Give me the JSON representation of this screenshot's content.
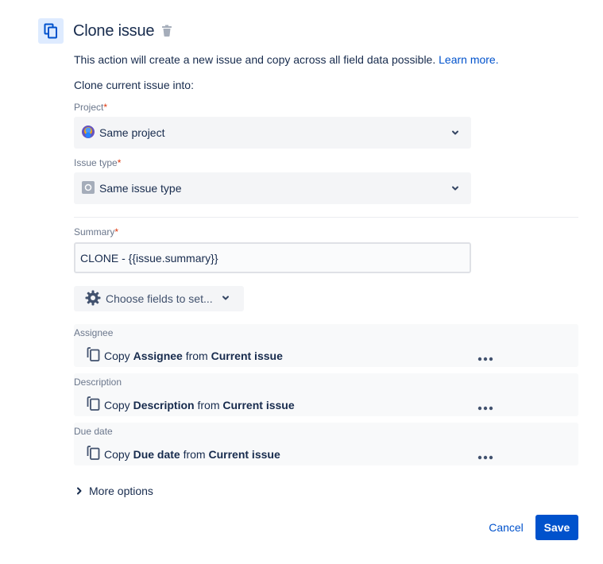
{
  "header": {
    "title": "Clone issue",
    "icon": "clone-icon",
    "delete_icon": "trash-icon",
    "accent_bg": "#deebff",
    "accent": "#0052cc"
  },
  "description": {
    "text": "This action will create a new issue and copy across all field data possible.",
    "link": "Learn more."
  },
  "subtitle": "Clone current issue into:",
  "project": {
    "label": "Project",
    "required": "*",
    "value": "Same project",
    "icon": "project-avatar-icon"
  },
  "issue_type": {
    "label": "Issue type",
    "required": "*",
    "value": "Same issue type",
    "icon": "issue-type-icon"
  },
  "summary": {
    "label": "Summary",
    "required": "*",
    "value": "CLONE - {{issue.summary}}"
  },
  "choose_fields": {
    "label": "Choose fields to set...",
    "icon": "gear-icon"
  },
  "fields": [
    {
      "label": "Assignee",
      "copy": "Copy",
      "field": "Assignee",
      "from": "from",
      "source": "Current issue"
    },
    {
      "label": "Description",
      "copy": "Copy",
      "field": "Description",
      "from": "from",
      "source": "Current issue"
    },
    {
      "label": "Due date",
      "copy": "Copy",
      "field": "Due date",
      "from": "from",
      "source": "Current issue"
    }
  ],
  "more_options": "More options",
  "actions": {
    "cancel": "Cancel",
    "save": "Save"
  }
}
